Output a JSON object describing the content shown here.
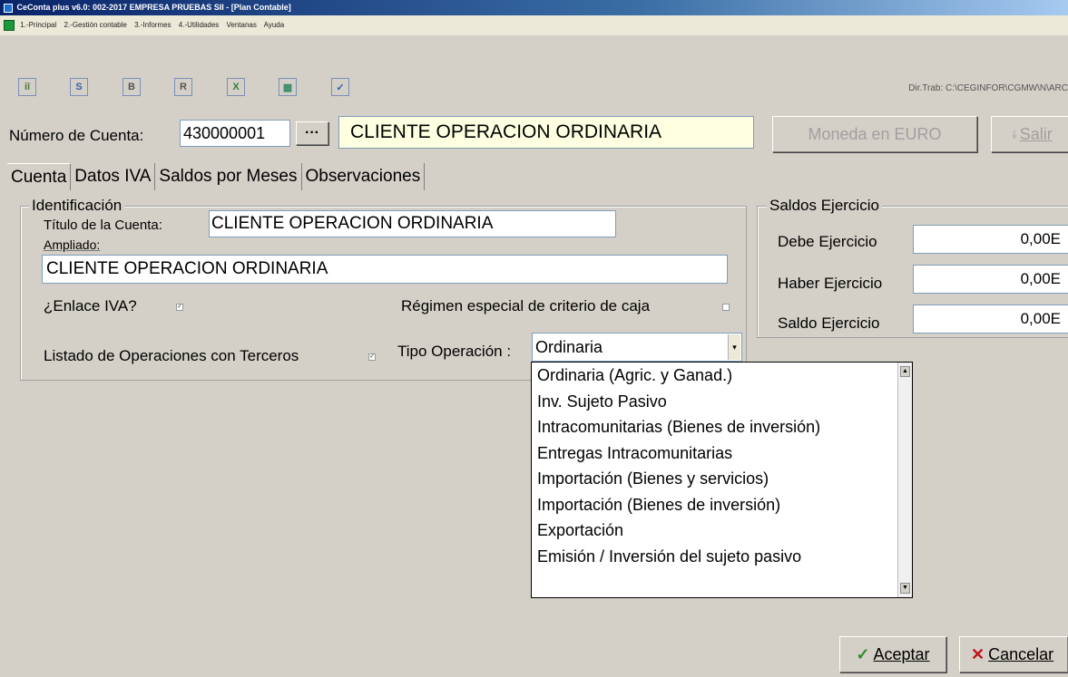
{
  "window": {
    "title": "CeConta plus v6.0: 002-2017 EMPRESA PRUEBAS SII - [Plan Contable]"
  },
  "menu": {
    "items": [
      "1.-Principal",
      "2.-Gestión contable",
      "3.-Informes",
      "4.-Utilidades",
      "Ventanas",
      "Ayuda"
    ]
  },
  "toolbar": {
    "buttons": [
      {
        "icon": "ledger-icon",
        "glyph": "iī",
        "color": "#4a7a3a"
      },
      {
        "icon": "s-icon",
        "glyph": "S",
        "color": "#3a5fa8"
      },
      {
        "icon": "b-icon",
        "glyph": "B",
        "color": "#555"
      },
      {
        "icon": "r-icon",
        "glyph": "R",
        "color": "#555"
      },
      {
        "icon": "x-icon",
        "glyph": "X",
        "color": "#2e7d32"
      },
      {
        "icon": "grid-icon",
        "glyph": "▦",
        "color": "#3a8a6a"
      },
      {
        "icon": "check-icon",
        "glyph": "✓",
        "color": "#2e5fa8"
      }
    ],
    "dir_trab": "Dir.Trab: C:\\CEGINFOR\\CGMW\\N\\ARC"
  },
  "account": {
    "number_label": "Número de Cuenta:",
    "number_value": "430000001",
    "browse_label": "···",
    "name_value": "CLIENTE OPERACION ORDINARIA",
    "currency_button": "Moneda en EURO",
    "exit_button": "Salir"
  },
  "tabs": [
    "Cuenta",
    "Datos IVA",
    "Saldos por Meses",
    "Observaciones"
  ],
  "identificacion": {
    "legend": "Identificación",
    "titulo_label": "Título de la Cuenta:",
    "titulo_value": "CLIENTE OPERACION ORDINARIA",
    "ampliado_label": "Ampliado:",
    "ampliado_value": "CLIENTE OPERACION ORDINARIA",
    "enlace_iva_label": "¿Enlace IVA?",
    "enlace_iva_checked": true,
    "regimen_label": "Régimen especial de criterio de caja",
    "regimen_checked": false,
    "listado_label": "Listado de Operaciones con Terceros",
    "listado_checked": true,
    "tipo_operacion_label": "Tipo Operación :",
    "tipo_operacion_value": "Ordinaria",
    "tipo_operacion_options": [
      "Ordinaria (Agric. y Ganad.)",
      "Inv. Sujeto Pasivo",
      "Intracomunitarias (Bienes de inversión)",
      "Entregas Intracomunitarias",
      "Importación (Bienes y servicios)",
      "Importación (Bienes de inversión)",
      "Exportación",
      "Emisión / Inversión del sujeto pasivo"
    ]
  },
  "saldos": {
    "legend": "Saldos Ejercicio",
    "debe_label": "Debe Ejercicio",
    "debe_value": "0,00E",
    "haber_label": "Haber Ejercicio",
    "haber_value": "0,00E",
    "saldo_label": "Saldo Ejercicio",
    "saldo_value": "0,00E"
  },
  "actions": {
    "aceptar_label": "Aceptar",
    "cancelar_label": "Cancelar"
  },
  "colors": {
    "name_field_bg": "#ffffe1",
    "accept_green": "#2e8b2e",
    "cancel_red": "#c0141a"
  }
}
